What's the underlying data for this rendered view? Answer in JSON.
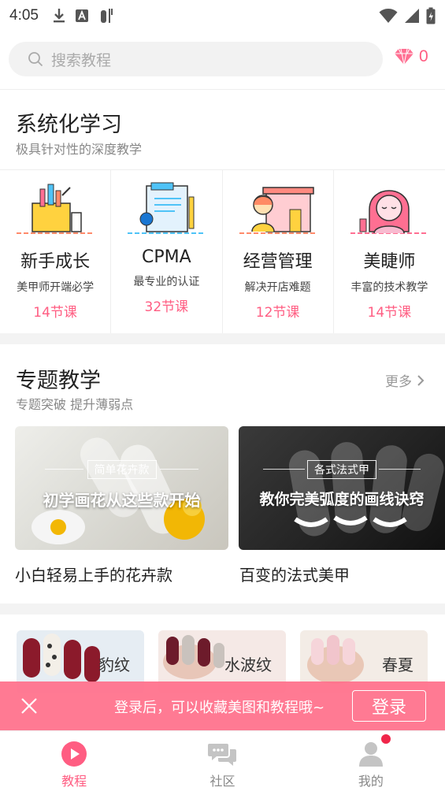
{
  "status": {
    "time": "4:05"
  },
  "search": {
    "placeholder": "搜索教程"
  },
  "gems": {
    "count": "0"
  },
  "systematic": {
    "title": "系统化学习",
    "subtitle": "极具针对性的深度教学",
    "courses": [
      {
        "name": "新手成长",
        "desc": "美甲师开端必学",
        "count": "14节课"
      },
      {
        "name": "CPMA",
        "desc": "最专业的认证",
        "count": "32节课"
      },
      {
        "name": "经营管理",
        "desc": "解决开店难题",
        "count": "12节课"
      },
      {
        "name": "美睫师",
        "desc": "丰富的技术教学",
        "count": "14节课"
      }
    ]
  },
  "topics": {
    "title": "专题教学",
    "subtitle": "专题突破 提升薄弱点",
    "more": "更多",
    "cards": [
      {
        "tag": "简单花卉款",
        "headline": "初学画花从这些款开始",
        "caption": "小白轻易上手的花卉款"
      },
      {
        "tag": "各式法式甲",
        "headline": "教你完美弧度的画线诀窍",
        "caption": "百变的法式美甲"
      }
    ]
  },
  "styles": [
    {
      "label": "豹纹"
    },
    {
      "label": "水波纹"
    },
    {
      "label": "春夏"
    }
  ],
  "login_banner": {
    "message": "登录后，可以收藏美图和教程哦~",
    "button": "登录"
  },
  "nav": [
    {
      "label": "教程",
      "active": true
    },
    {
      "label": "社区",
      "active": false
    },
    {
      "label": "我的",
      "active": false
    }
  ],
  "colors": {
    "accent": "#ff5d82",
    "banner": "#ff708b"
  }
}
